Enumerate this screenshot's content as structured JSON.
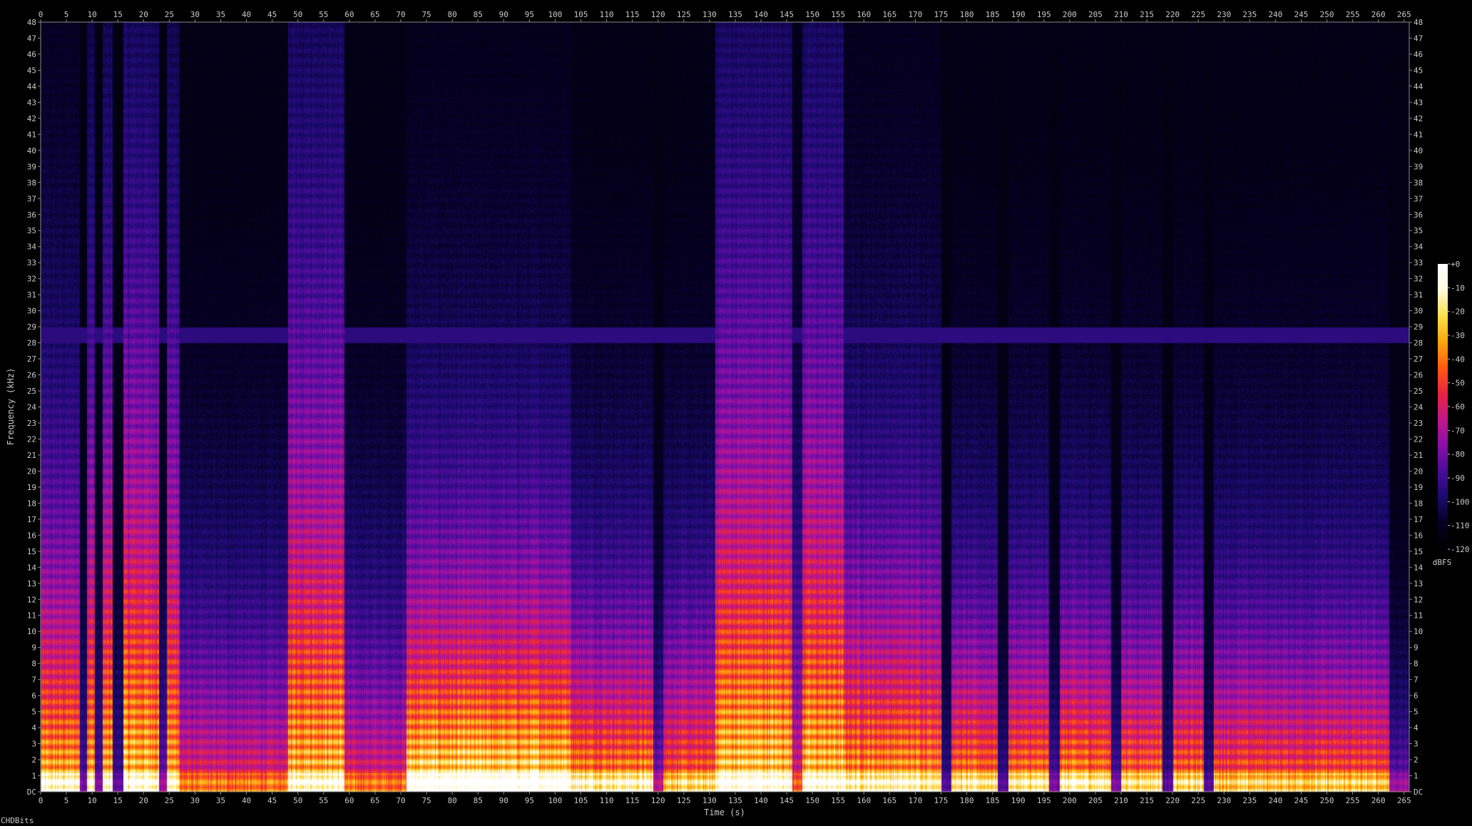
{
  "chart_data": {
    "type": "heatmap",
    "x_axis": {
      "label": "Time (s)",
      "range": [
        0,
        266
      ],
      "ticks": [
        0,
        5,
        10,
        15,
        20,
        25,
        30,
        35,
        40,
        45,
        50,
        55,
        60,
        65,
        70,
        75,
        80,
        85,
        90,
        95,
        100,
        105,
        110,
        115,
        120,
        125,
        130,
        135,
        140,
        145,
        150,
        155,
        160,
        165,
        170,
        175,
        180,
        185,
        190,
        195,
        200,
        205,
        210,
        215,
        220,
        225,
        230,
        235,
        240,
        245,
        250,
        255,
        260,
        265
      ]
    },
    "y_axis": {
      "label": "Frequency (kHz)",
      "range": [
        0,
        48
      ],
      "ticks": [
        "DC",
        "1",
        "2",
        "3",
        "4",
        "5",
        "6",
        "7",
        "8",
        "9",
        "10",
        "11",
        "12",
        "13",
        "14",
        "15",
        "16",
        "17",
        "18",
        "19",
        "20",
        "21",
        "22",
        "23",
        "24",
        "25",
        "26",
        "27",
        "28",
        "29",
        "30",
        "31",
        "32",
        "33",
        "34",
        "35",
        "36",
        "37",
        "38",
        "39",
        "40",
        "41",
        "42",
        "43",
        "44",
        "45",
        "46",
        "47",
        "48"
      ]
    },
    "colorbar": {
      "label": "dBFS",
      "range": [
        -120,
        0
      ],
      "ticks": [
        "+0",
        "-10",
        "-20",
        "-30",
        "-40",
        "-50",
        "-60",
        "-70",
        "-80",
        "-90",
        "-100",
        "-110",
        "-120"
      ],
      "colors": [
        "#000000",
        "#050020",
        "#1a0a6e",
        "#4a0c9a",
        "#8a0fa8",
        "#c0178a",
        "#e8233f",
        "#ff5a10",
        "#ffa610",
        "#ffe04a",
        "#fffae0",
        "#ffffff"
      ]
    },
    "segments": [
      {
        "start": 0,
        "end": 7.5,
        "level": 0.82,
        "hf": 0.55
      },
      {
        "start": 7.5,
        "end": 9,
        "level": 0.25,
        "hf": 0.3
      },
      {
        "start": 9,
        "end": 10.5,
        "level": 0.8,
        "hf": 0.8
      },
      {
        "start": 10.5,
        "end": 12,
        "level": 0.25,
        "hf": 0.3
      },
      {
        "start": 12,
        "end": 14,
        "level": 0.8,
        "hf": 0.85
      },
      {
        "start": 14,
        "end": 16,
        "level": 0.22,
        "hf": 0.3
      },
      {
        "start": 16,
        "end": 23,
        "level": 0.85,
        "hf": 0.9
      },
      {
        "start": 23,
        "end": 24.5,
        "level": 0.3,
        "hf": 0.3
      },
      {
        "start": 24.5,
        "end": 27,
        "level": 0.8,
        "hf": 0.85
      },
      {
        "start": 27,
        "end": 48,
        "level": 0.55,
        "hf": 0.35
      },
      {
        "start": 48,
        "end": 59,
        "level": 0.85,
        "hf": 0.9
      },
      {
        "start": 59,
        "end": 71,
        "level": 0.55,
        "hf": 0.35
      },
      {
        "start": 71,
        "end": 103,
        "level": 0.95,
        "hf": 0.45
      },
      {
        "start": 103,
        "end": 119,
        "level": 0.8,
        "hf": 0.35
      },
      {
        "start": 119,
        "end": 121,
        "level": 0.35,
        "hf": 0.25
      },
      {
        "start": 121,
        "end": 131,
        "level": 0.7,
        "hf": 0.35
      },
      {
        "start": 131,
        "end": 146,
        "level": 0.88,
        "hf": 0.9
      },
      {
        "start": 146,
        "end": 148,
        "level": 0.5,
        "hf": 0.5
      },
      {
        "start": 148,
        "end": 156,
        "level": 0.85,
        "hf": 0.9
      },
      {
        "start": 156,
        "end": 175,
        "level": 0.8,
        "hf": 0.5
      },
      {
        "start": 175,
        "end": 177,
        "level": 0.2,
        "hf": 0.2
      },
      {
        "start": 177,
        "end": 186,
        "level": 0.75,
        "hf": 0.35
      },
      {
        "start": 186,
        "end": 188,
        "level": 0.2,
        "hf": 0.2
      },
      {
        "start": 188,
        "end": 196,
        "level": 0.75,
        "hf": 0.35
      },
      {
        "start": 196,
        "end": 198,
        "level": 0.25,
        "hf": 0.2
      },
      {
        "start": 198,
        "end": 208,
        "level": 0.78,
        "hf": 0.35
      },
      {
        "start": 208,
        "end": 210,
        "level": 0.25,
        "hf": 0.2
      },
      {
        "start": 210,
        "end": 218,
        "level": 0.75,
        "hf": 0.35
      },
      {
        "start": 218,
        "end": 220,
        "level": 0.2,
        "hf": 0.2
      },
      {
        "start": 220,
        "end": 226,
        "level": 0.72,
        "hf": 0.35
      },
      {
        "start": 226,
        "end": 228,
        "level": 0.2,
        "hf": 0.2
      },
      {
        "start": 228,
        "end": 262,
        "level": 0.68,
        "hf": 0.35
      },
      {
        "start": 262,
        "end": 266,
        "level": 0.3,
        "hf": 0.2
      }
    ],
    "hum_band_khz": 28.5
  },
  "credit": "CHDBits"
}
